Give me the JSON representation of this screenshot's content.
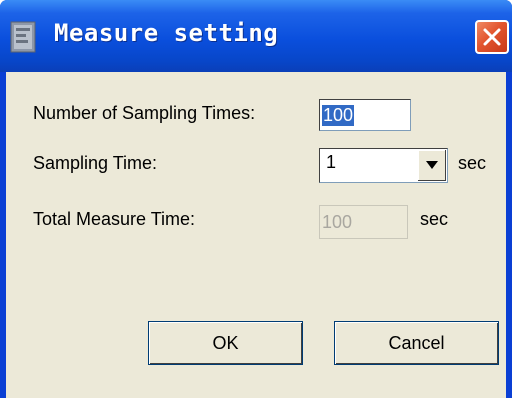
{
  "window": {
    "title": "Measure setting",
    "icon": "app-window-icon",
    "close_icon": "close-icon"
  },
  "fields": {
    "sampling_times_label": "Number of Sampling Times:",
    "sampling_times_value": "100",
    "sampling_time_label": "Sampling Time:",
    "sampling_time_value": "1",
    "sampling_time_unit": "sec",
    "total_time_label": "Total Measure Time:",
    "total_time_value": "100",
    "total_time_unit": "sec"
  },
  "buttons": {
    "ok": "OK",
    "cancel": "Cancel"
  },
  "colors": {
    "titlebar": "#0a4fdd",
    "client_bg": "#ece9d8",
    "selection": "#316ac5",
    "close": "#e2552e"
  }
}
